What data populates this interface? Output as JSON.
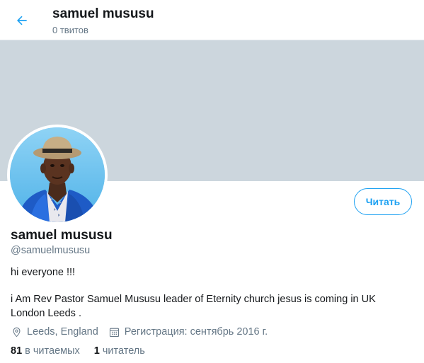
{
  "header": {
    "title": "samuel mususu",
    "tweet_count": "0 твитов",
    "back_icon": "arrow-left-icon"
  },
  "colors": {
    "accent": "#1da1f2",
    "banner": "#ccd6dd",
    "secondary_text": "#657786"
  },
  "profile": {
    "display_name": "samuel mususu",
    "handle": "@samuelmususu",
    "follow_label": "Читать",
    "bio_line1": "hi everyone !!!",
    "bio_line2": "i Am Rev Pastor Samuel Mususu leader of Eternity church jesus is coming in UK London Leeds .",
    "location": "Leeds, England",
    "location_icon": "location-pin-icon",
    "joined": "Регистрация: сентябрь 2016 г.",
    "joined_icon": "calendar-icon"
  },
  "stats": {
    "following_count": "81",
    "following_label": "в читаемых",
    "followers_count": "1",
    "followers_label": "читатель"
  }
}
